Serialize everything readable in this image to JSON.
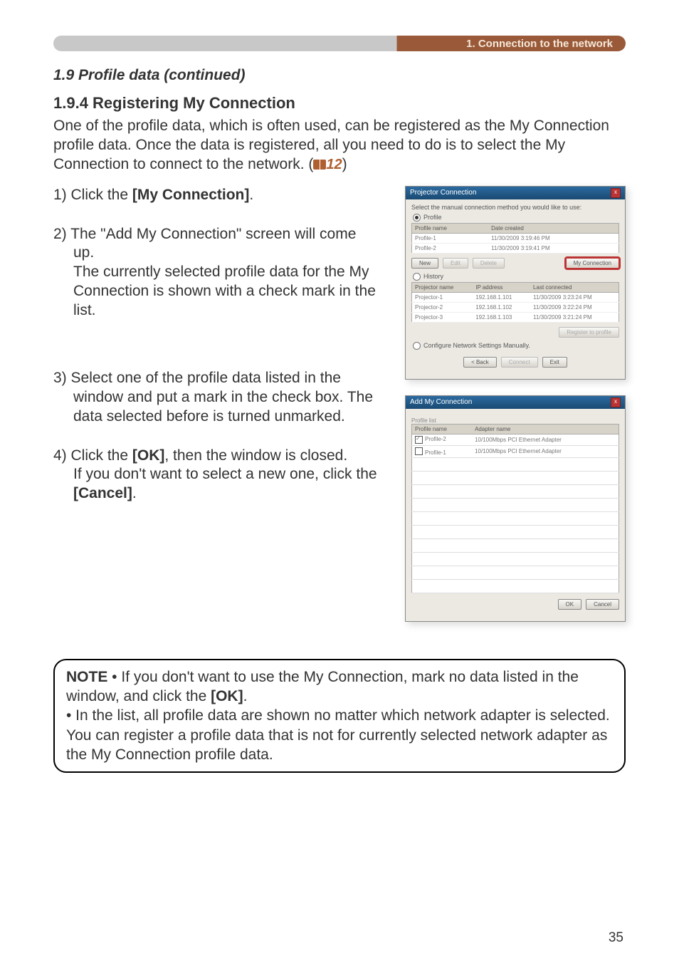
{
  "topbar": {
    "text": "1. Connection to the network"
  },
  "section_title": "1.9 Profile data (continued)",
  "subsection_title": "1.9.4 Registering My Connection",
  "intro_a": "One of the profile data, which is often used, can be registered as the My Connection profile data. Once the data is registered, all you need to do is to select the My Connection to connect to the network. (",
  "intro_ref": "12",
  "intro_b": ")",
  "step1_a": "1) Click the ",
  "step1_b": "[My Connection]",
  "step1_c": ".",
  "step2_a": "2) The \"Add My Connection\" screen will come",
  "step2_b": "up.",
  "step2_c": "The currently selected profile data for the My Connection is shown with a check mark in the list.",
  "step3_a": "3) Select one of the profile data listed in the",
  "step3_b": "window and put a mark in the check box. The data selected before is turned unmarked.",
  "step4_a": "4) Click the ",
  "step4_b": "[OK]",
  "step4_c": ", then the window is closed.",
  "step4_d": "If you don't want to select a new one, click the ",
  "step4_e": "[Cancel]",
  "step4_f": ".",
  "dlg1": {
    "title": "Projector Connection",
    "prompt": "Select the manual connection method you would like to use:",
    "radio_profile": "Profile",
    "radio_history": "History",
    "radio_manual": "Configure Network Settings Manually.",
    "profile_headers": {
      "c1": "Profile name",
      "c2": "Date created"
    },
    "profiles": [
      {
        "name": "Profile-1",
        "date": "11/30/2009 3:19:46 PM"
      },
      {
        "name": "Profile-2",
        "date": "11/30/2009 3:19:41 PM"
      }
    ],
    "history_headers": {
      "c1": "Projector name",
      "c2": "IP address",
      "c3": "Last connected"
    },
    "history": [
      {
        "name": "Projector-1",
        "ip": "192.168.1.101",
        "last": "11/30/2009 3:23:24 PM"
      },
      {
        "name": "Projector-2",
        "ip": "192.168.1.102",
        "last": "11/30/2009 3:22:24 PM"
      },
      {
        "name": "Projector-3",
        "ip": "192.168.1.103",
        "last": "11/30/2009 3:21:24 PM"
      }
    ],
    "buttons": {
      "new": "New",
      "edit": "Edit",
      "delete": "Delete",
      "myconn": "My Connection",
      "register": "Register to profile",
      "back": "< Back",
      "connect": "Connect",
      "exit": "Exit"
    }
  },
  "dlg2": {
    "title": "Add My Connection",
    "list_label": "Profile list",
    "headers": {
      "c1": "Profile name",
      "c2": "Adapter name"
    },
    "rows": [
      {
        "checked": true,
        "name": "Profile-2",
        "adapter": "10/100Mbps PCI Ethernet Adapter"
      },
      {
        "checked": false,
        "name": "Profile-1",
        "adapter": "10/100Mbps PCI Ethernet Adapter"
      }
    ],
    "ok": "OK",
    "cancel": "Cancel"
  },
  "note": {
    "label": "NOTE",
    "line1a": " • If you don't want to use the My Connection, mark no data listed in the window, and click the ",
    "line1b": "[OK]",
    "line1c": ".",
    "line2": "• In the list, all profile data are shown no matter which network adapter is selected. You can register a profile data that is not for currently selected network adapter as the My Connection profile data."
  },
  "page_number": "35"
}
